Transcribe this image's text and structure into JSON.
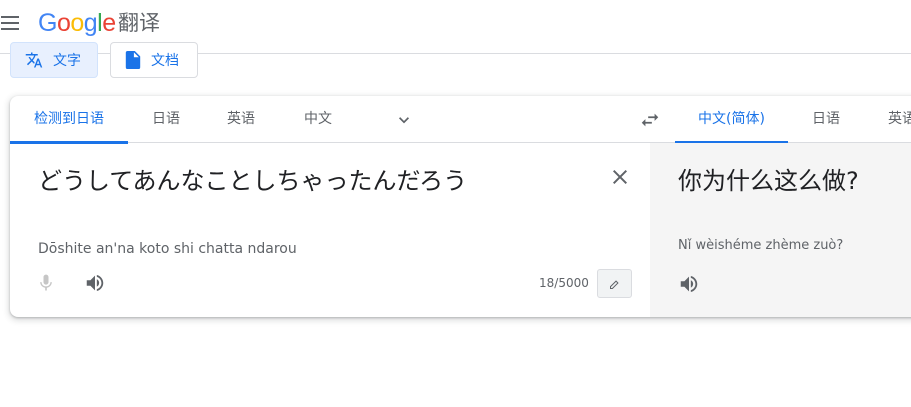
{
  "header": {
    "logo_letters": [
      "G",
      "o",
      "o",
      "g",
      "l",
      "e"
    ],
    "product_name": "翻译"
  },
  "modes": [
    {
      "label": "文字",
      "icon": "translate-icon",
      "active": true
    },
    {
      "label": "文档",
      "icon": "document-icon",
      "active": false
    }
  ],
  "source_languages": {
    "tabs": [
      "检测到日语",
      "日语",
      "英语",
      "中文"
    ],
    "active_index": 0
  },
  "target_languages": {
    "tabs": [
      "中文(简体)",
      "日语",
      "英语"
    ],
    "active_index": 0
  },
  "source": {
    "text": "どうしてあんなことしちゃったんだろう",
    "transliteration": "Dōshite an'na koto shi chatta ndarou",
    "char_count": "18/5000"
  },
  "target": {
    "text": "你为什么这么做?",
    "transliteration": "Nǐ wèishéme zhème zuò?"
  },
  "colors": {
    "accent": "#1a73e8",
    "active_mode_bg": "#e8f0fe",
    "target_pane_bg": "#f5f5f5"
  }
}
